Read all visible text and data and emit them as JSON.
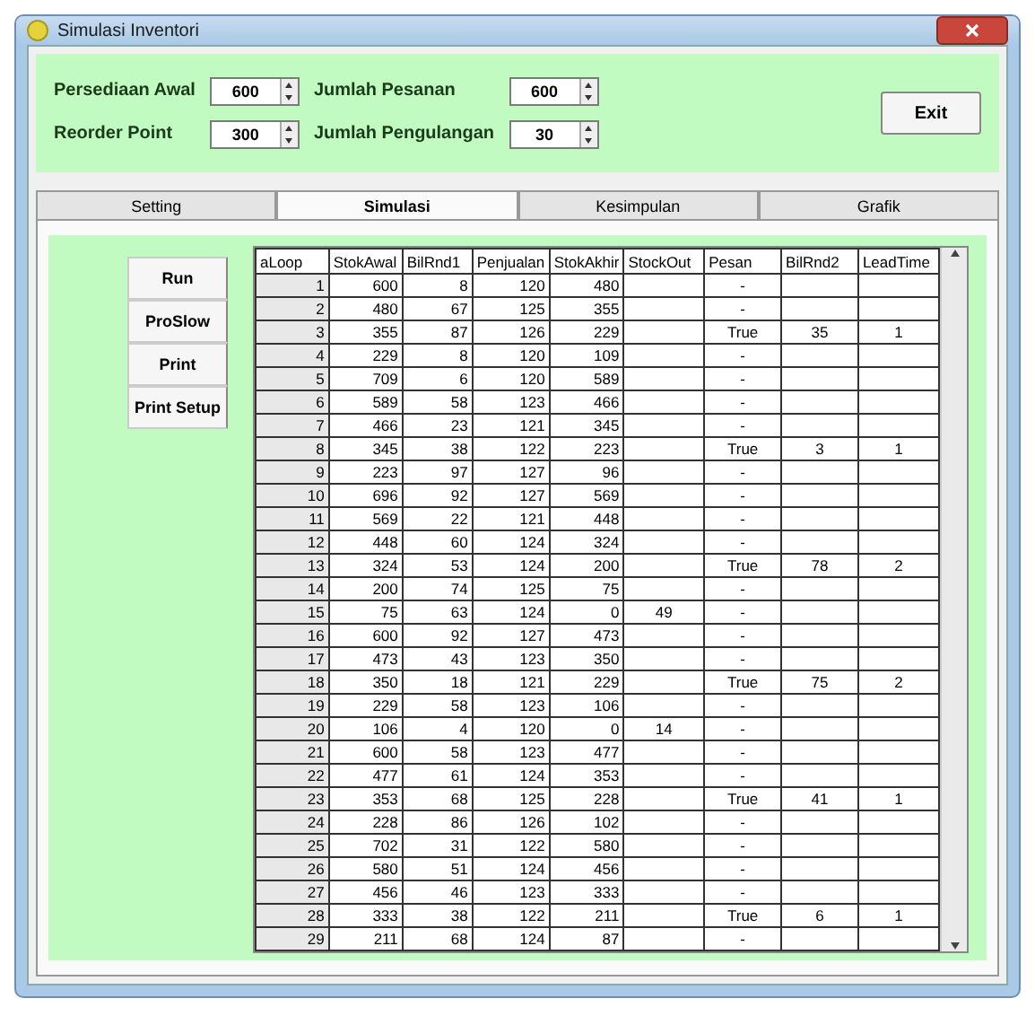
{
  "window": {
    "title": "Simulasi Inventori"
  },
  "inputs": [
    {
      "label": "Persediaan Awal",
      "value": "600"
    },
    {
      "label": "Reorder Point",
      "value": "300"
    },
    {
      "label": "Jumlah Pesanan",
      "value": "600"
    },
    {
      "label": "Jumlah Pengulangan",
      "value": "30"
    }
  ],
  "exit_button": "Exit",
  "tabs": [
    {
      "label": "Setting",
      "selected": false
    },
    {
      "label": "Simulasi",
      "selected": true
    },
    {
      "label": "Kesimpulan",
      "selected": false
    },
    {
      "label": "Grafik",
      "selected": false
    }
  ],
  "side_buttons": [
    "Run",
    "ProSlow",
    "Print",
    "Print Setup"
  ],
  "table": {
    "columns": [
      "aLoop",
      "StokAwal",
      "BilRnd1",
      "Penjualan",
      "StokAkhir",
      "StockOut",
      "Pesan",
      "BilRnd2",
      "LeadTime"
    ],
    "rows": [
      [
        "1",
        "600",
        "8",
        "120",
        "480",
        "",
        "-",
        "",
        ""
      ],
      [
        "2",
        "480",
        "67",
        "125",
        "355",
        "",
        "-",
        "",
        ""
      ],
      [
        "3",
        "355",
        "87",
        "126",
        "229",
        "",
        "True",
        "35",
        "1"
      ],
      [
        "4",
        "229",
        "8",
        "120",
        "109",
        "",
        "-",
        "",
        ""
      ],
      [
        "5",
        "709",
        "6",
        "120",
        "589",
        "",
        "-",
        "",
        ""
      ],
      [
        "6",
        "589",
        "58",
        "123",
        "466",
        "",
        "-",
        "",
        ""
      ],
      [
        "7",
        "466",
        "23",
        "121",
        "345",
        "",
        "-",
        "",
        ""
      ],
      [
        "8",
        "345",
        "38",
        "122",
        "223",
        "",
        "True",
        "3",
        "1"
      ],
      [
        "9",
        "223",
        "97",
        "127",
        "96",
        "",
        "-",
        "",
        ""
      ],
      [
        "10",
        "696",
        "92",
        "127",
        "569",
        "",
        "-",
        "",
        ""
      ],
      [
        "11",
        "569",
        "22",
        "121",
        "448",
        "",
        "-",
        "",
        ""
      ],
      [
        "12",
        "448",
        "60",
        "124",
        "324",
        "",
        "-",
        "",
        ""
      ],
      [
        "13",
        "324",
        "53",
        "124",
        "200",
        "",
        "True",
        "78",
        "2"
      ],
      [
        "14",
        "200",
        "74",
        "125",
        "75",
        "",
        "-",
        "",
        ""
      ],
      [
        "15",
        "75",
        "63",
        "124",
        "0",
        "49",
        "-",
        "",
        ""
      ],
      [
        "16",
        "600",
        "92",
        "127",
        "473",
        "",
        "-",
        "",
        ""
      ],
      [
        "17",
        "473",
        "43",
        "123",
        "350",
        "",
        "-",
        "",
        ""
      ],
      [
        "18",
        "350",
        "18",
        "121",
        "229",
        "",
        "True",
        "75",
        "2"
      ],
      [
        "19",
        "229",
        "58",
        "123",
        "106",
        "",
        "-",
        "",
        ""
      ],
      [
        "20",
        "106",
        "4",
        "120",
        "0",
        "14",
        "-",
        "",
        ""
      ],
      [
        "21",
        "600",
        "58",
        "123",
        "477",
        "",
        "-",
        "",
        ""
      ],
      [
        "22",
        "477",
        "61",
        "124",
        "353",
        "",
        "-",
        "",
        ""
      ],
      [
        "23",
        "353",
        "68",
        "125",
        "228",
        "",
        "True",
        "41",
        "1"
      ],
      [
        "24",
        "228",
        "86",
        "126",
        "102",
        "",
        "-",
        "",
        ""
      ],
      [
        "25",
        "702",
        "31",
        "122",
        "580",
        "",
        "-",
        "",
        ""
      ],
      [
        "26",
        "580",
        "51",
        "124",
        "456",
        "",
        "-",
        "",
        ""
      ],
      [
        "27",
        "456",
        "46",
        "123",
        "333",
        "",
        "-",
        "",
        ""
      ],
      [
        "28",
        "333",
        "38",
        "122",
        "211",
        "",
        "True",
        "6",
        "1"
      ],
      [
        "29",
        "211",
        "68",
        "124",
        "87",
        "",
        "-",
        "",
        ""
      ]
    ]
  }
}
